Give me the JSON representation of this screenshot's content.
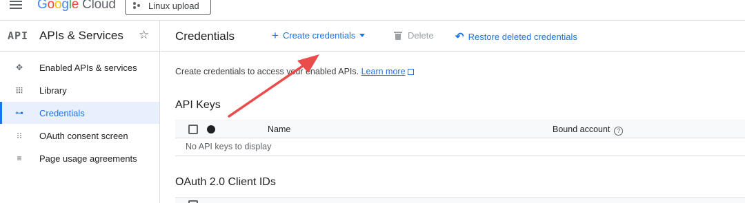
{
  "topbar": {
    "menu_icon": "hamburger-menu-icon",
    "logo": {
      "google": "Google",
      "cloud": "Cloud"
    },
    "project": "Linux upload"
  },
  "sidebar": {
    "logo_text": "API",
    "title": "APIs & Services",
    "items": [
      {
        "label": "Enabled APIs & services",
        "icon": "enabled-apis-icon",
        "active": false
      },
      {
        "label": "Library",
        "icon": "library-icon",
        "active": false
      },
      {
        "label": "Credentials",
        "icon": "key-icon",
        "active": true
      },
      {
        "label": "OAuth consent screen",
        "icon": "oauth-consent-icon",
        "active": false
      },
      {
        "label": "Page usage agreements",
        "icon": "settings-list-icon",
        "active": false
      }
    ]
  },
  "header": {
    "title": "Credentials",
    "actions": {
      "create": "Create credentials",
      "delete": "Delete",
      "restore": "Restore deleted credentials"
    }
  },
  "content": {
    "intro_text": "Create credentials to access your enabled APIs.",
    "learn_more": "Learn more",
    "api_keys": {
      "title": "API Keys",
      "columns": [
        "Name",
        "Bound account"
      ],
      "empty_text": "No API keys to display"
    },
    "oauth": {
      "title": "OAuth 2.0 Client IDs"
    }
  },
  "colors": {
    "accent": "#1a73e8",
    "annotation_arrow": "#ea4c4c"
  }
}
